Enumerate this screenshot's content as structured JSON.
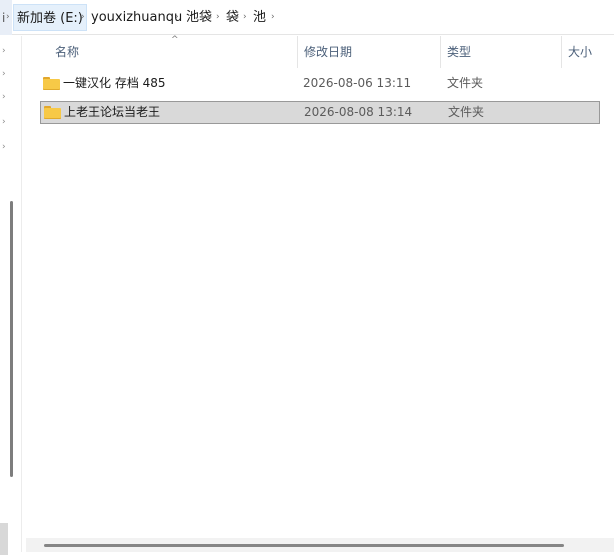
{
  "address": {
    "crumbs": [
      "新加卷 (E:)",
      "youxizhuanqu",
      "池袋",
      "袋",
      "池"
    ],
    "separator": "›",
    "left_mark": "i"
  },
  "columns": {
    "name": "名称",
    "date_modified": "修改日期",
    "type": "类型",
    "size": "大小",
    "sort_indicator": "^"
  },
  "files": [
    {
      "name": "一键汉化 存档 485",
      "date": "2026-08-06 13:11",
      "type": "文件夹",
      "icon": "folder-icon",
      "selected": false
    },
    {
      "name": "上老王论坛当老王",
      "date": "2026-08-08 13:14",
      "type": "文件夹",
      "icon": "folder-icon",
      "selected": true
    }
  ],
  "nav": {
    "chevron": "›"
  },
  "colors": {
    "selection_bg": "#d9d9d9",
    "selection_border": "#999999",
    "folder": "#f7c947"
  }
}
